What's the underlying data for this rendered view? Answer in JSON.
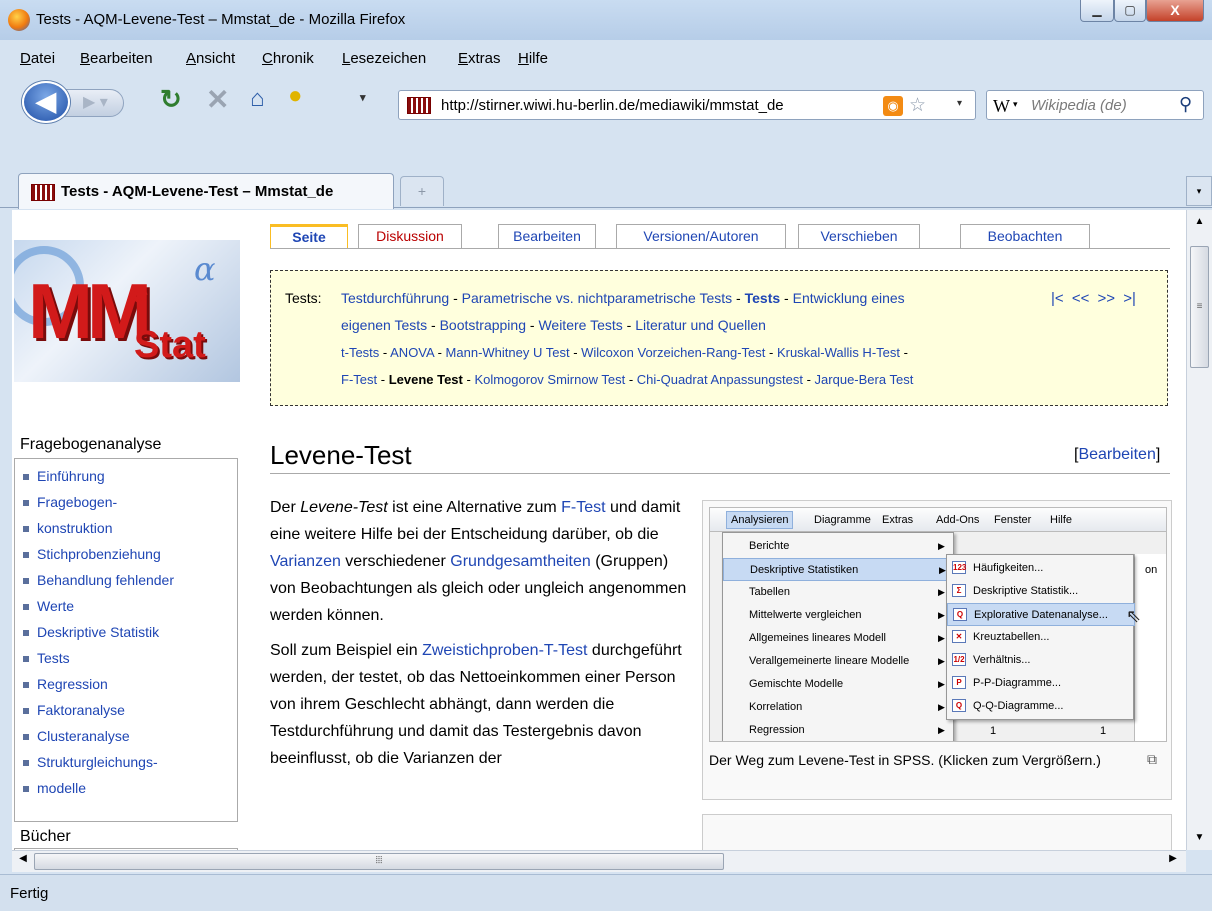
{
  "window": {
    "title": "Tests - AQM-Levene-Test – Mmstat_de - Mozilla Firefox",
    "min": "▁",
    "max": "▢",
    "close": "X"
  },
  "menu": [
    "Datei",
    "Bearbeiten",
    "Ansicht",
    "Chronik",
    "Lesezeichen",
    "Extras",
    "Hilfe"
  ],
  "nav": {
    "url": "http://stirner.wiwi.hu-berlin.de/mediawiki/mmstat_de",
    "search_placeholder": "Wikipedia (de)",
    "search_logo": "W"
  },
  "tab": {
    "title": "Tests - AQM-Levene-Test – Mmstat_de",
    "new": "+"
  },
  "status": "Fertig",
  "sidebar": {
    "section1": "Fragebogenanalyse",
    "items": [
      "Einführung",
      "Fragebogen-",
      "konstruktion",
      "Stichprobenziehung",
      "Behandlung fehlender",
      "Werte",
      "Deskriptive Statistik",
      "Tests",
      "Regression",
      "Faktoranalyse",
      "Clusteranalyse",
      "Strukturgleichungs-",
      "modelle"
    ],
    "section2": "Bücher"
  },
  "page_tabs": [
    "Seite",
    "Diskussion",
    "Bearbeiten",
    "Versionen/Autoren",
    "Verschieben",
    "Beobachten"
  ],
  "navbox": {
    "prefix": "Tests:",
    "pager": "|< << >> >|",
    "line1": [
      "Testdurchführung",
      " - ",
      "Parametrische vs. nichtparametrische Tests",
      " - ",
      "Tests",
      " - ",
      "Entwicklung eines"
    ],
    "line2": [
      "eigenen Tests",
      " - ",
      "Bootstrapping",
      " - ",
      "Weitere Tests",
      " - ",
      "Literatur und Quellen"
    ],
    "line3": [
      "t-Tests",
      " - ",
      "ANOVA",
      " - ",
      "Mann-Whitney U Test",
      " - ",
      "Wilcoxon Vorzeichen-Rang-Test",
      " - ",
      "Kruskal-Wallis H-Test",
      " -"
    ],
    "line4": [
      "F-Test",
      " - ",
      "Levene Test",
      " - ",
      "Kolmogorov Smirnow Test",
      " - ",
      "Chi-Quadrat Anpassungstest",
      " - ",
      "Jarque-Bera Test"
    ]
  },
  "heading": "Levene-Test",
  "edit": "Bearbeiten",
  "body": {
    "p1": [
      "Der ",
      "Levene-Test",
      " ist eine Alternative zum ",
      "F-Test",
      " und damit eine weitere Hilfe bei der Entscheidung darüber, ob die ",
      "Varianzen",
      " verschiedener ",
      "Grundgesamtheiten",
      " (Gruppen) von Beobachtungen als gleich oder ungleich angenommen werden können."
    ],
    "p2": [
      "Soll zum Beispiel ein ",
      "Zweistichproben-T-Test",
      " durchgeführt werden, der testet, ob das Nettoeinkommen einer Person von ihrem Geschlecht abhängt, dann werden die Testdurchführung und damit das Testergebnis davon beeinflusst, ob die Varianzen der"
    ]
  },
  "figure": {
    "menubar": [
      "Analysieren",
      "Diagramme",
      "Extras",
      "Add-Ons",
      "Fenster",
      "Hilfe"
    ],
    "menu1": [
      "Berichte",
      "Deskriptive Statistiken",
      "Tabellen",
      "Mittelwerte vergleichen",
      "Allgemeines lineares Modell",
      "Verallgemeinerte lineare Modelle",
      "Gemischte Modelle",
      "Korrelation",
      "Regression"
    ],
    "menu2": [
      "Häufigkeiten...",
      "Deskriptive Statistik...",
      "Explorative Datenanalyse...",
      "Kreuztabellen...",
      "Verhältnis...",
      "P-P-Diagramme...",
      "Q-Q-Diagramme..."
    ],
    "menu2_icons": [
      "123",
      "Σ",
      "Q",
      "✕",
      "1/2",
      "P",
      "Q"
    ],
    "rest": "on",
    "cells": [
      "1",
      "1"
    ],
    "caption": "Der Weg zum Levene-Test in SPSS. (Klicken zum Vergrößern.)"
  }
}
